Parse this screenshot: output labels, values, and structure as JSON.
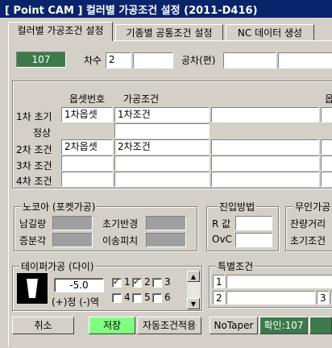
{
  "window": {
    "title": "[ Point CAM ]   컬러별 가공조건 설정   (2011-D416)"
  },
  "tabs": [
    {
      "label": "컬러별 가공조건 설정",
      "active": true
    },
    {
      "label": "기종별 공통조건 설정",
      "active": false
    },
    {
      "label": "NC 데이터 생성",
      "active": false
    }
  ],
  "header": {
    "color_code": "107",
    "order_label": "차수",
    "order_value": "2",
    "tolerance_label": "공차(편)"
  },
  "grid": {
    "col_offset_no": "옵셋번호",
    "col_condition": "가공조건",
    "col_offset_cut": "옵",
    "rows": [
      {
        "label": "1차 초기",
        "offset": "1차옵셋",
        "condition": "1차조건"
      },
      {
        "label": "정상",
        "offset": "",
        "condition": ""
      },
      {
        "label": "2차 조건",
        "offset": "2차옵셋",
        "condition": "2차조건"
      },
      {
        "label": "3차 조건",
        "offset": "",
        "condition": ""
      },
      {
        "label": "4차 조건",
        "offset": "",
        "condition": ""
      }
    ]
  },
  "nokoa": {
    "title": "노코아 (포켓가공)",
    "remain": "남길량",
    "init_radius": "초기반경",
    "inc_angle": "증분각",
    "pitch": "이송피치"
  },
  "entry": {
    "title": "진입방법",
    "r_label": "R 값",
    "ovc_label": "OvC"
  },
  "nocore": {
    "title": "무인가공",
    "remain_dist": "잔량거리",
    "init_cond": "초기조건"
  },
  "taper": {
    "title": "테이퍼가공 (다이)",
    "value": "-5.0",
    "sign_note": "(+)정  (-)역",
    "checks": [
      {
        "label": "1",
        "checked": true
      },
      {
        "label": "2",
        "checked": true
      },
      {
        "label": "3",
        "checked": false
      },
      {
        "label": "4",
        "checked": false
      },
      {
        "label": "5",
        "checked": false
      },
      {
        "label": "6",
        "checked": false
      }
    ]
  },
  "special": {
    "title": "특별조건",
    "n1": "1",
    "n2": "2",
    "n3": "3"
  },
  "buttons": {
    "cancel": "취소",
    "save": "저장",
    "auto_apply": "자동조건적용",
    "no_taper": "NoTaper",
    "confirm": "확인:107"
  },
  "colors": {
    "title_bg": "#08246b",
    "code_green": "#3c7a4c",
    "save_green": "#80ff80",
    "confirm_green": "#3c7a4c"
  },
  "icons": {
    "spin_up": "arrow-up-icon",
    "spin_down": "arrow-down-icon",
    "taper_shape": "taper-die-icon"
  }
}
